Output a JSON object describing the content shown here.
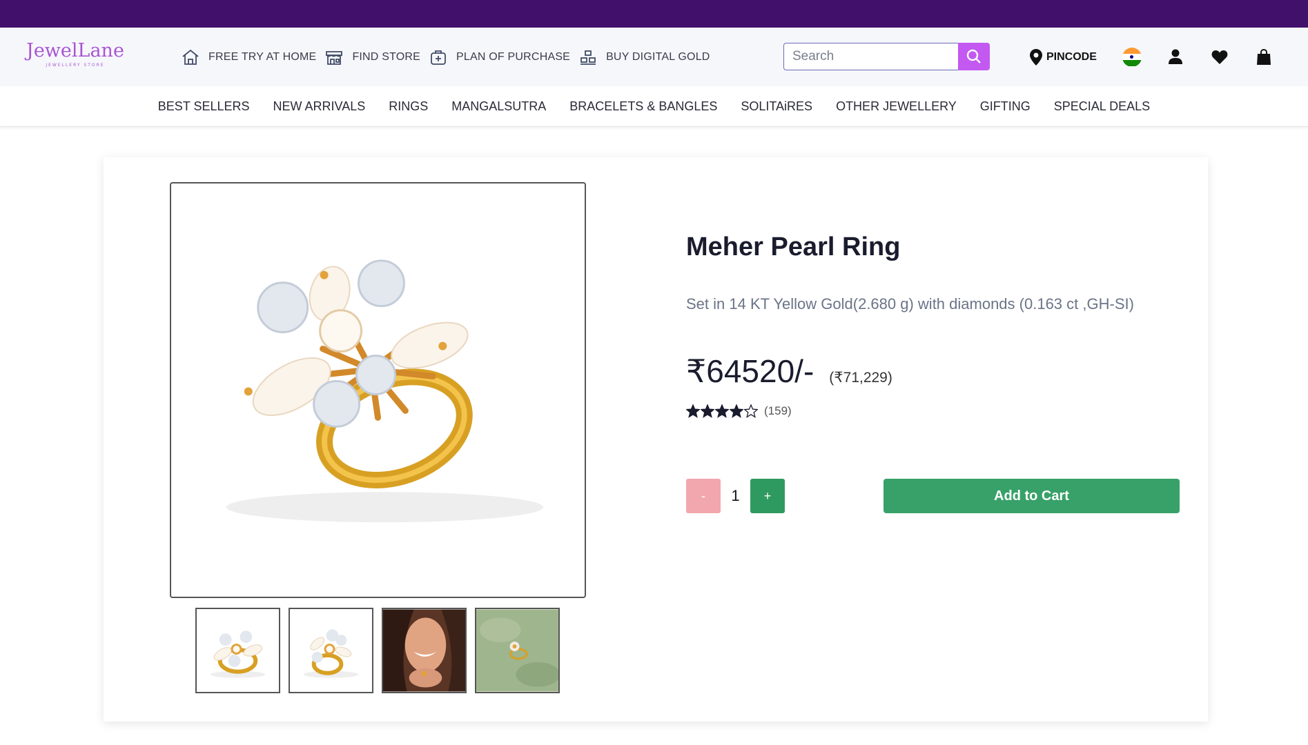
{
  "brand": {
    "name": "JewelLane",
    "tagline": "JEWELLERY STORE",
    "color": "#a855d4"
  },
  "topbar_color": "#40106a",
  "quick_links": [
    {
      "label": "FREE TRY AT HOME",
      "icon": "home-icon"
    },
    {
      "label": "FIND STORE",
      "icon": "store-icon"
    },
    {
      "label": "PLAN OF PURCHASE",
      "icon": "plan-icon"
    },
    {
      "label": "BUY DIGITAL GOLD",
      "icon": "gold-bars-icon"
    }
  ],
  "search": {
    "placeholder": "Search",
    "value": "",
    "button_color": "#c359f0"
  },
  "tools": {
    "pincode_label": "PINCODE",
    "country": "India"
  },
  "categories": [
    "BEST SELLERS",
    "NEW ARRIVALS",
    "RINGS",
    "MANGALSUTRA",
    "BRACELETS & BANGLES",
    "SOLITAiRES",
    "OTHER JEWELLERY",
    "GIFTING",
    "SPECIAL DEALS"
  ],
  "product": {
    "title": "Meher Pearl Ring",
    "description": "Set in 14 KT Yellow Gold(2.680 g) with diamonds (0.163 ct ,GH-SI)",
    "price": "₹64520/-",
    "mrp": "(₹71,229)",
    "rating": 4,
    "rating_max": 5,
    "reviews": "(159)",
    "quantity": "1",
    "minus_label": "-",
    "plus_label": "+",
    "add_to_cart_label": "Add to Cart",
    "add_to_cart_color": "#38a169",
    "thumbnails": [
      "ring-front",
      "ring-angle",
      "model-wearing-ring",
      "ring-on-green-background"
    ]
  }
}
